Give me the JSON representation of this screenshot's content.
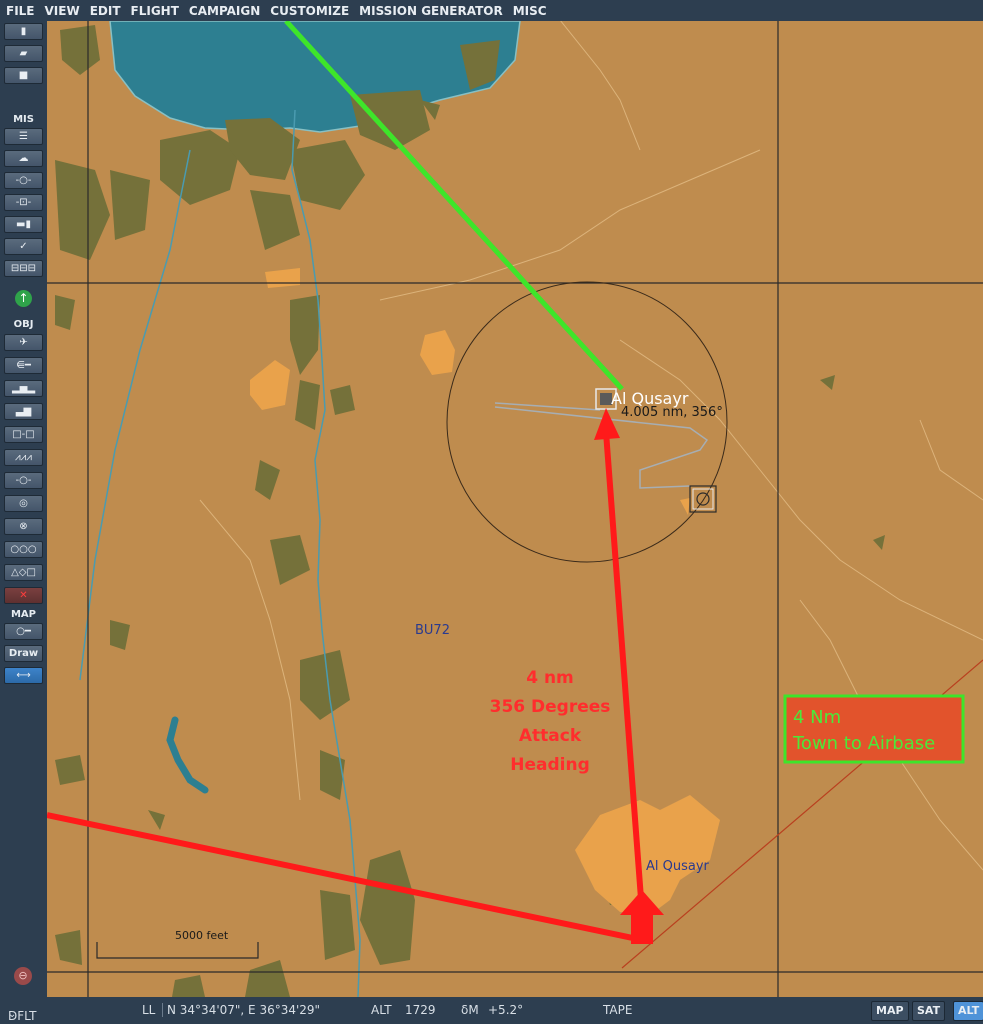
{
  "menu": [
    "FILE",
    "VIEW",
    "EDIT",
    "FLIGHT",
    "CAMPAIGN",
    "CUSTOMIZE",
    "MISSION GENERATOR",
    "MISC"
  ],
  "sidebar": {
    "file_buttons": [
      "new-file-icon",
      "open-file-icon",
      "save-file-icon"
    ],
    "mis_label": "MIS",
    "mis_buttons": [
      "briefing-icon",
      "weather-icon",
      "trigger-zone-icon",
      "triggers-icon",
      "goals-icon",
      "check-icon",
      "resources-icon"
    ],
    "up_arrow_icon": "arrow-up-circle-icon",
    "obj_label": "OBJ",
    "obj_buttons": [
      "aircraft-icon",
      "helicopter-icon",
      "ship-icon",
      "vehicle-icon",
      "static-object-icon",
      "template-icon",
      "waypoint-icon",
      "target-zone-icon",
      "airdrome-icon",
      "group-icon",
      "shapes-icon",
      "delete-icon"
    ],
    "map_label": "MAP",
    "ruler_icon": "ruler-icon",
    "draw_label": "Draw",
    "measure_icon": "measure-icon"
  },
  "map": {
    "airbase_label": "Al Qusayr",
    "measure_readout": "4.005 nm, 356°",
    "grid_label": "BU72",
    "town_label": "Al Qusayr",
    "annotation_lines": [
      "4 nm",
      "356 Degrees",
      "Attack",
      "Heading"
    ],
    "box_lines": [
      "4 Nm",
      "Town to Airbase"
    ],
    "scale_label": "5000 feet",
    "colors": {
      "land": "#bf8c4e",
      "water": "#2d7f91",
      "forest": "#75713a",
      "town": "#e9a24b",
      "route_green": "#3ee52a",
      "route_red": "#ff1a1a",
      "annotation_text": "#ff2d2d",
      "box_text": "#4ce83a"
    }
  },
  "status": {
    "profile": "DFLT",
    "coord_mode": "LL",
    "coords": "N 34°34'07\", E 36°34'29\"",
    "alt_label": "ALT",
    "alt_value": "1729",
    "mag_label": "δM",
    "mag_value": "+5.2°",
    "tape": "TAPE",
    "map_modes": [
      "MAP",
      "SAT",
      "ALT"
    ],
    "active_mode": "ALT"
  }
}
